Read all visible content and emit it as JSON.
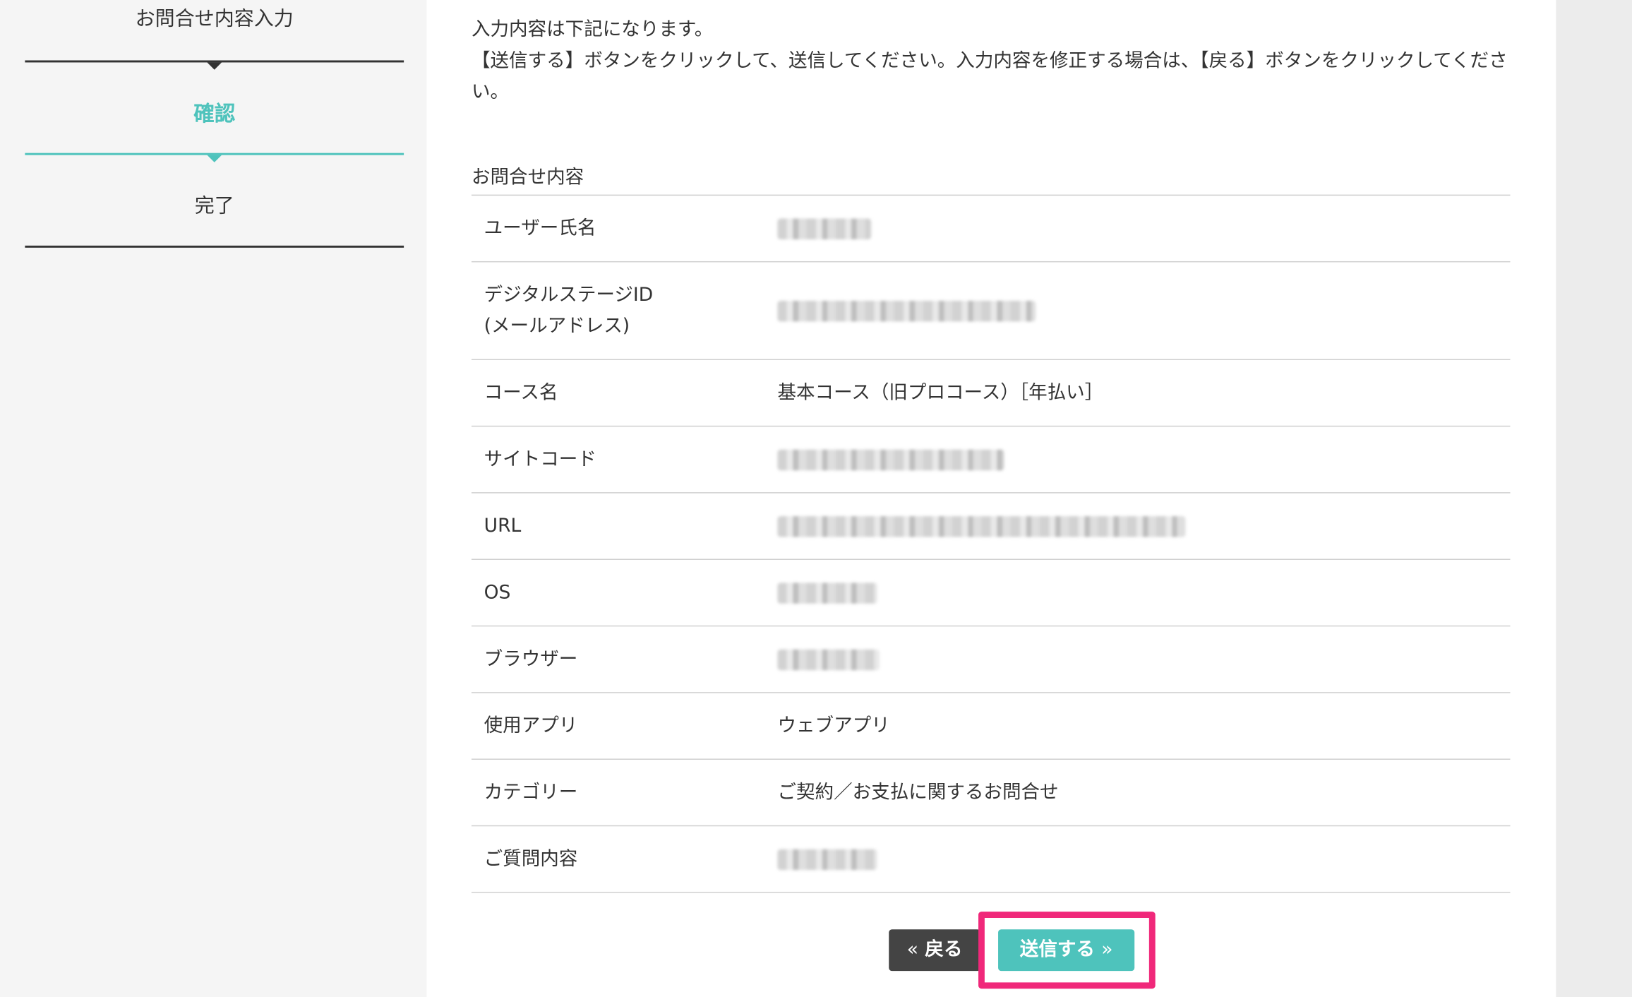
{
  "colors": {
    "accent": "#4ec3bc",
    "highlight": "#f0287a",
    "back_button": "#444444",
    "text": "#333333"
  },
  "steps": {
    "input": "お問合せ内容入力",
    "confirm": "確認",
    "done": "完了"
  },
  "intro": {
    "line1": "入力内容は下記になります。",
    "line2": "【送信する】ボタンをクリックして、送信してください。入力内容を修正する場合は、【戻る】ボタンをクリックしてください。"
  },
  "section_title": "お問合せ内容",
  "rows": {
    "user_name": {
      "label": "ユーザー氏名"
    },
    "digital_stage_id": {
      "label_line1": "デジタルステージID",
      "label_line2": "(メールアドレス)"
    },
    "course": {
      "label": "コース名",
      "value": "基本コース（旧プロコース）［年払い］"
    },
    "site_code": {
      "label": "サイトコード"
    },
    "url": {
      "label": "URL"
    },
    "os": {
      "label": "OS"
    },
    "browser": {
      "label": "ブラウザー"
    },
    "app": {
      "label": "使用アプリ",
      "value": "ウェブアプリ"
    },
    "category": {
      "label": "カテゴリー",
      "value": "ご契約／お支払に関するお問合せ"
    },
    "question": {
      "label": "ご質問内容"
    }
  },
  "buttons": {
    "back_chevron": "«",
    "back_label": "戻る",
    "send_label": "送信する",
    "send_chevron": "»"
  }
}
